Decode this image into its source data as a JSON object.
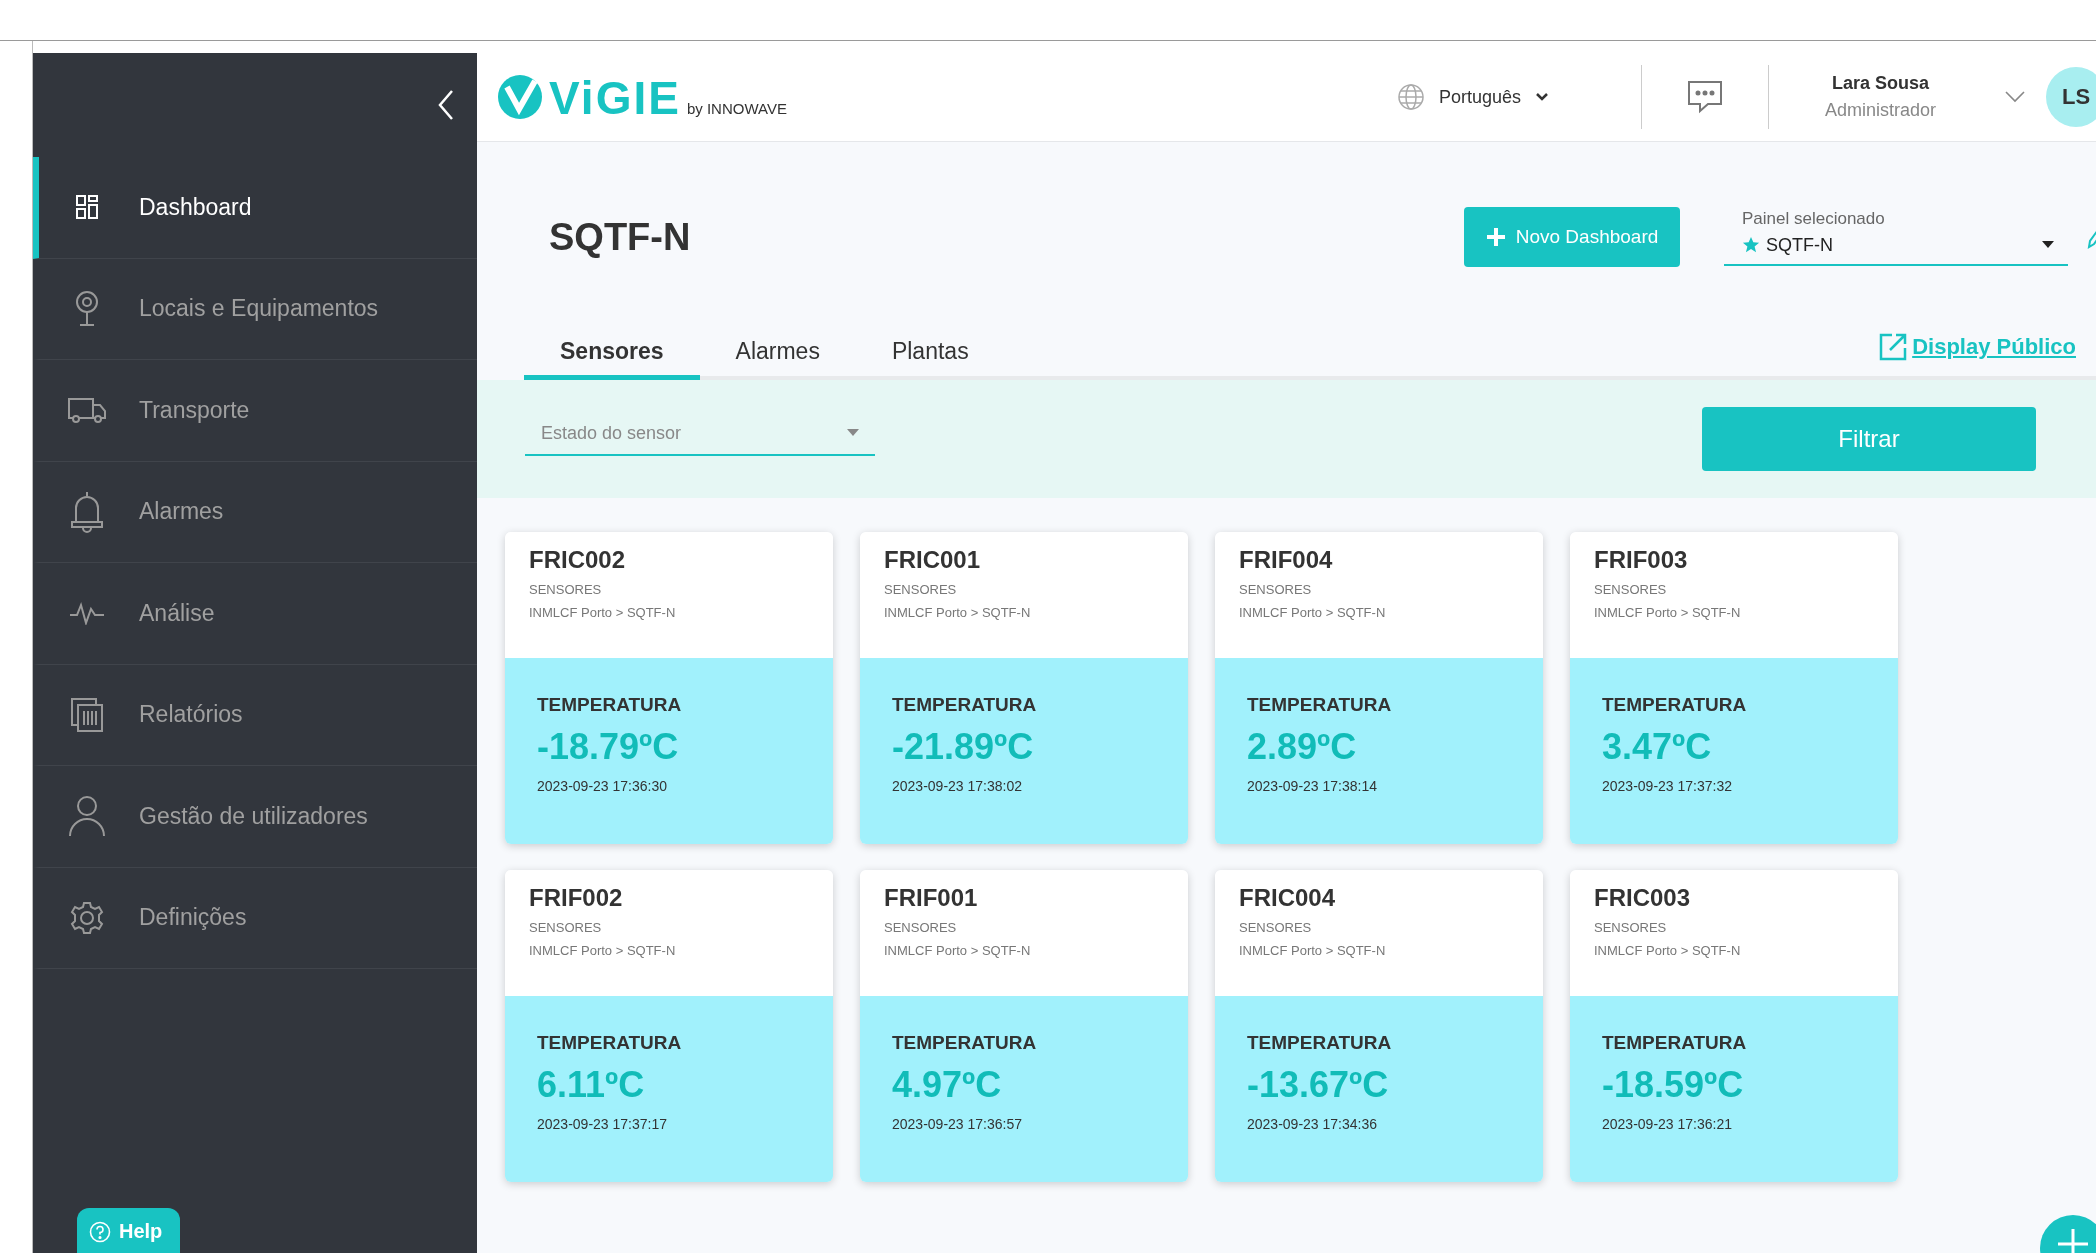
{
  "sidebar": {
    "items": [
      {
        "label": "Dashboard",
        "selected": true
      },
      {
        "label": "Locais e Equipamentos",
        "selected": false
      },
      {
        "label": "Transporte",
        "selected": false
      },
      {
        "label": "Alarmes",
        "selected": false
      },
      {
        "label": "Análise",
        "selected": false
      },
      {
        "label": "Relatórios",
        "selected": false
      },
      {
        "label": "Gestão de utilizadores",
        "selected": false
      },
      {
        "label": "Definições",
        "selected": false
      }
    ],
    "help": "Help"
  },
  "header": {
    "logo": "ViGIE",
    "logo_by": "by INNOWAVE",
    "language": "Português",
    "user_name": "Lara Sousa",
    "user_role": "Administrador",
    "avatar": "LS"
  },
  "page": {
    "title": "SQTF-N",
    "new_button": "Novo Dashboard",
    "panel_label": "Painel selecionado",
    "panel_value": "SQTF-N",
    "public_link": "Display Público"
  },
  "tabs": [
    {
      "label": "Sensores",
      "selected": true
    },
    {
      "label": "Alarmes",
      "selected": false
    },
    {
      "label": "Plantas",
      "selected": false
    }
  ],
  "filter": {
    "placeholder": "Estado do sensor",
    "button": "Filtrar"
  },
  "cards": [
    {
      "name": "FRIC002",
      "type": "SENSORES",
      "path": "INMLCF Porto > SQTF-N",
      "metric": "TEMPERATURA",
      "value": "-18.79ºC",
      "time": "2023-09-23 17:36:30"
    },
    {
      "name": "FRIC001",
      "type": "SENSORES",
      "path": "INMLCF Porto > SQTF-N",
      "metric": "TEMPERATURA",
      "value": "-21.89ºC",
      "time": "2023-09-23 17:38:02"
    },
    {
      "name": "FRIF004",
      "type": "SENSORES",
      "path": "INMLCF Porto > SQTF-N",
      "metric": "TEMPERATURA",
      "value": "2.89ºC",
      "time": "2023-09-23 17:38:14"
    },
    {
      "name": "FRIF003",
      "type": "SENSORES",
      "path": "INMLCF Porto > SQTF-N",
      "metric": "TEMPERATURA",
      "value": "3.47ºC",
      "time": "2023-09-23 17:37:32"
    },
    {
      "name": "FRIF002",
      "type": "SENSORES",
      "path": "INMLCF Porto > SQTF-N",
      "metric": "TEMPERATURA",
      "value": "6.11ºC",
      "time": "2023-09-23 17:37:17"
    },
    {
      "name": "FRIF001",
      "type": "SENSORES",
      "path": "INMLCF Porto > SQTF-N",
      "metric": "TEMPERATURA",
      "value": "4.97ºC",
      "time": "2023-09-23 17:36:57"
    },
    {
      "name": "FRIC004",
      "type": "SENSORES",
      "path": "INMLCF Porto > SQTF-N",
      "metric": "TEMPERATURA",
      "value": "-13.67ºC",
      "time": "2023-09-23 17:34:36"
    },
    {
      "name": "FRIC003",
      "type": "SENSORES",
      "path": "INMLCF Porto > SQTF-N",
      "metric": "TEMPERATURA",
      "value": "-18.59ºC",
      "time": "2023-09-23 17:36:21"
    }
  ]
}
